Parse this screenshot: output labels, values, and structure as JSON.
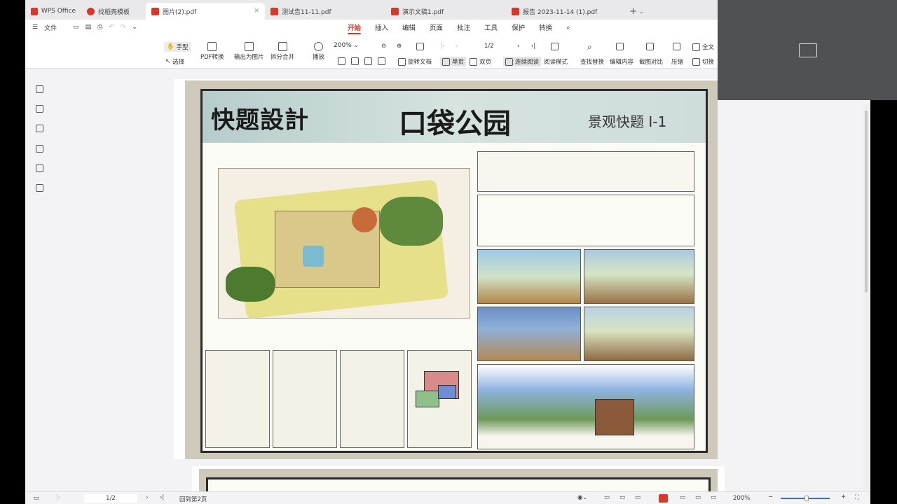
{
  "tabs": [
    {
      "label": "WPS Office",
      "color": "#d8372a",
      "active": false
    },
    {
      "label": "找稻壳模板",
      "color": "#d8372a",
      "active": false
    },
    {
      "label": "图片(2).pdf",
      "color": "#d8372a",
      "active": true
    },
    {
      "label": "测试告11-11.pdf",
      "color": "#d8372a",
      "active": false
    },
    {
      "label": "演示文稿1.pdf",
      "color": "#d8372a",
      "active": false
    },
    {
      "label": "报告 2023-11-14 (1).pdf",
      "color": "#d8372a",
      "active": false
    }
  ],
  "menu": {
    "file": "文件",
    "tabs": [
      "开始",
      "插入",
      "编辑",
      "页面",
      "批注",
      "工具",
      "保护",
      "转换"
    ],
    "active_tab": "开始"
  },
  "ribbon": {
    "hand": "手型",
    "select": "选择",
    "pdf_convert": "PDF转换",
    "export_image": "输出为图片",
    "split_merge": "拆分合并",
    "play": "播放",
    "zoom": "200%",
    "page_counter": "1/2",
    "rotate": "旋转文档",
    "single": "单页",
    "double": "双页",
    "continuous": "连续阅读",
    "read_mode": "阅读模式",
    "find_replace": "查找替换",
    "edit_content": "编辑内容",
    "crop_compare": "截图对比",
    "compress": "压缩",
    "full_text": "全文",
    "switch": "切换"
  },
  "poster": {
    "title_left": "快题設計",
    "title_right": "口袋公园",
    "subtitle": "景观快题 I-1"
  },
  "statusbar": {
    "page_input": "1/2",
    "back_label": "回到第2页",
    "zoom": "200%"
  }
}
